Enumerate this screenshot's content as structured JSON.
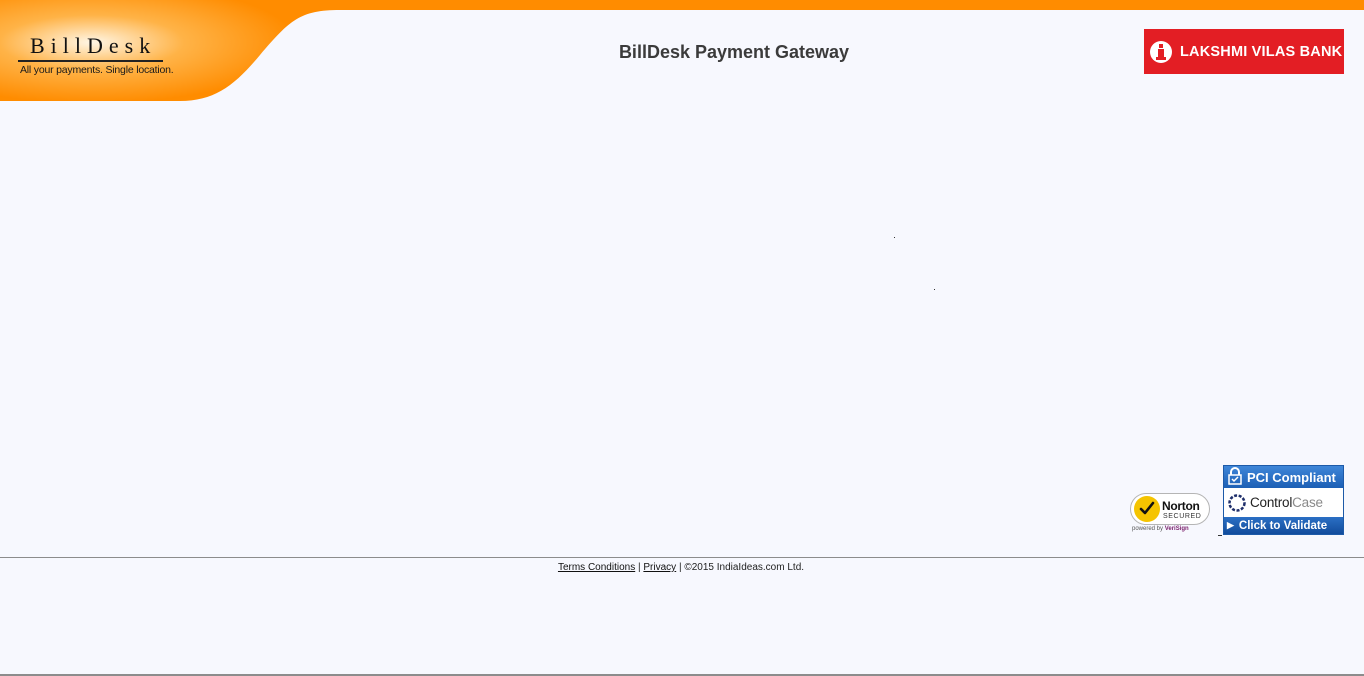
{
  "header": {
    "logo": {
      "name": "BillDesk",
      "tagline": "All your payments. Single location."
    },
    "title": "BillDesk Payment Gateway",
    "bank_logo": {
      "name": "LAKSHMI VILAS BANK",
      "color": "#e31e24"
    },
    "accent_color": "#ff8c00"
  },
  "badges": {
    "norton": {
      "brand": "Norton",
      "label": "SECURED",
      "powered_prefix": "powered by",
      "powered_brand": "VeriSign"
    },
    "pci": {
      "title": "PCI Compliant",
      "brand_primary": "Control",
      "brand_secondary": "Case",
      "action": "Click to Validate"
    }
  },
  "footer": {
    "terms_label": "Terms Conditions",
    "separator": "|",
    "privacy_label": "Privacy",
    "copyright": "©2015 IndiaIdeas.com Ltd."
  }
}
